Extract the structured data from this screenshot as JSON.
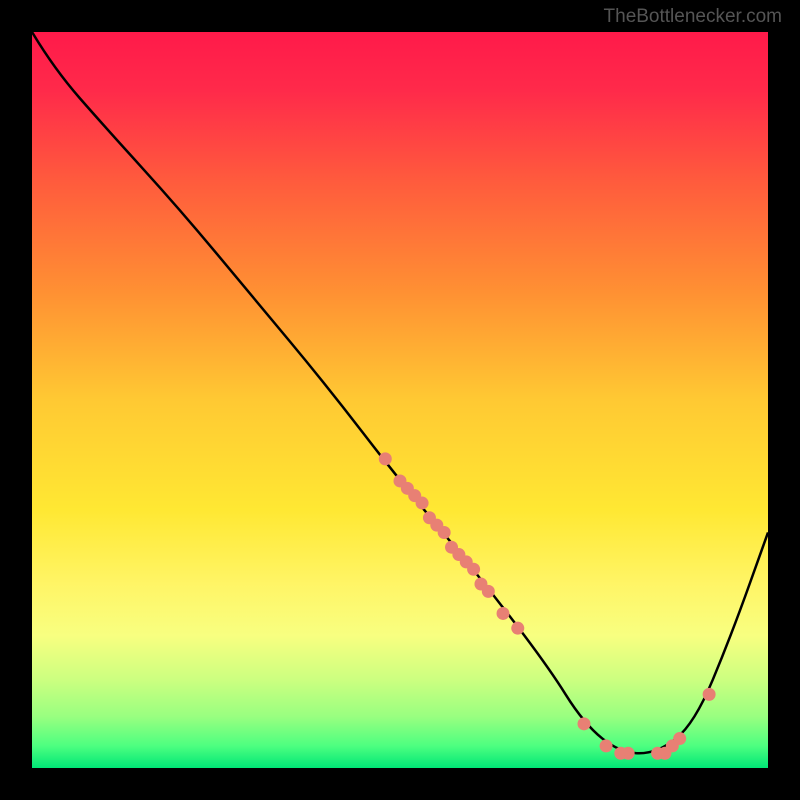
{
  "watermark": "TheBottlenecker.com",
  "colors": {
    "bg_top": "#ff1a4a",
    "bg_mid1": "#ff6b3d",
    "bg_mid2": "#ffd633",
    "bg_mid3": "#fff566",
    "bg_mid4": "#ccff66",
    "bg_bottom": "#00e676",
    "curve": "#000000",
    "dots": "#e88074"
  },
  "chart_data": {
    "type": "line",
    "title": "",
    "xlabel": "",
    "ylabel": "",
    "xlim": [
      0,
      100
    ],
    "ylim": [
      0,
      100
    ],
    "series": [
      {
        "name": "bottleneck-curve",
        "x": [
          0,
          3,
          10,
          20,
          30,
          40,
          50,
          60,
          70,
          75,
          80,
          85,
          90,
          95,
          100
        ],
        "y": [
          100,
          95,
          87,
          76,
          64,
          52,
          39,
          27,
          14,
          6,
          2,
          2,
          6,
          18,
          32
        ]
      }
    ],
    "scatter_points": {
      "name": "highlighted-points",
      "x": [
        48,
        50,
        51,
        52,
        53,
        54,
        55,
        56,
        57,
        58,
        59,
        60,
        61,
        62,
        64,
        66,
        75,
        78,
        80,
        81,
        85,
        86,
        87,
        88,
        92
      ],
      "y": [
        42,
        39,
        38,
        37,
        36,
        34,
        33,
        32,
        30,
        29,
        28,
        27,
        25,
        24,
        21,
        19,
        6,
        3,
        2,
        2,
        2,
        2,
        3,
        4,
        10
      ]
    }
  }
}
